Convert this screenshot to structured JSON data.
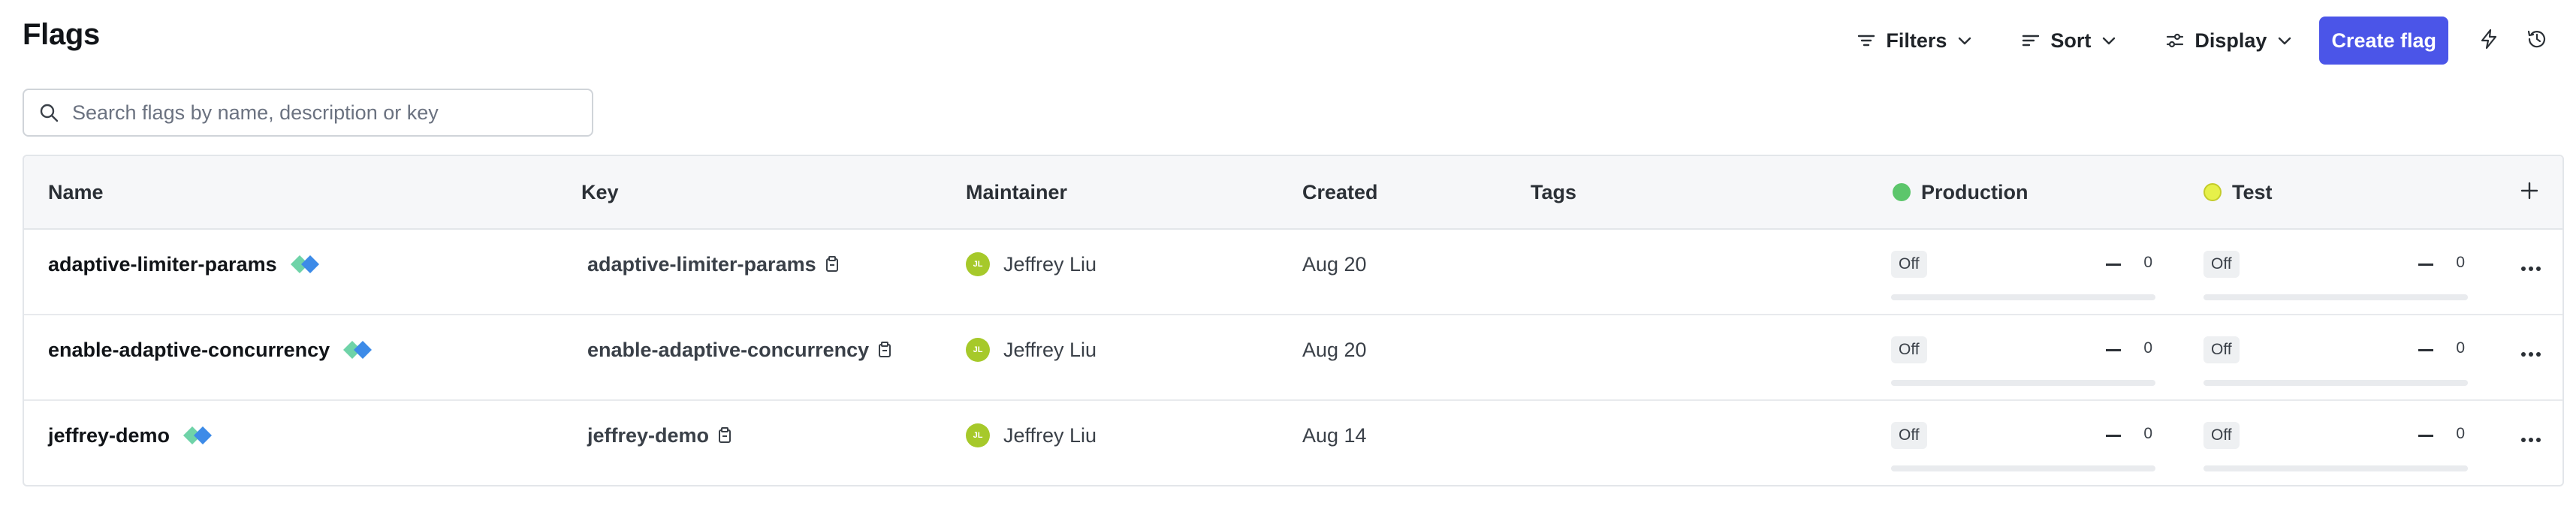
{
  "header": {
    "title": "Flags",
    "filters_label": "Filters",
    "sort_label": "Sort",
    "display_label": "Display",
    "create_label": "Create flag"
  },
  "search": {
    "placeholder": "Search flags by name, description or key",
    "value": ""
  },
  "table": {
    "columns": {
      "name": "Name",
      "key": "Key",
      "maintainer": "Maintainer",
      "created": "Created",
      "tags": "Tags",
      "production": "Production",
      "test": "Test"
    },
    "env_colors": {
      "production": "#5cc66b",
      "test": "#e6f04a"
    },
    "rows": [
      {
        "name": "adaptive-limiter-params",
        "key": "adaptive-limiter-params",
        "maintainer_initials": "JL",
        "maintainer": "Jeffrey Liu",
        "created": "Aug 20",
        "production": {
          "status": "Off",
          "count": "0"
        },
        "test": {
          "status": "Off",
          "count": "0"
        }
      },
      {
        "name": "enable-adaptive-concurrency",
        "key": "enable-adaptive-concurrency",
        "maintainer_initials": "JL",
        "maintainer": "Jeffrey Liu",
        "created": "Aug 20",
        "production": {
          "status": "Off",
          "count": "0"
        },
        "test": {
          "status": "Off",
          "count": "0"
        }
      },
      {
        "name": "jeffrey-demo",
        "key": "jeffrey-demo",
        "maintainer_initials": "JL",
        "maintainer": "Jeffrey Liu",
        "created": "Aug 14",
        "production": {
          "status": "Off",
          "count": "0"
        },
        "test": {
          "status": "Off",
          "count": "0"
        }
      }
    ]
  },
  "colors": {
    "accent": "#4b55e8",
    "avatar": "#a6c92a"
  },
  "icons": [
    "filter-icon",
    "sort-icon",
    "display-icon",
    "chevron-down-icon",
    "lightning-icon",
    "history-icon",
    "search-icon",
    "plus-icon",
    "flag-type-icon",
    "copy-icon",
    "more-icon"
  ]
}
